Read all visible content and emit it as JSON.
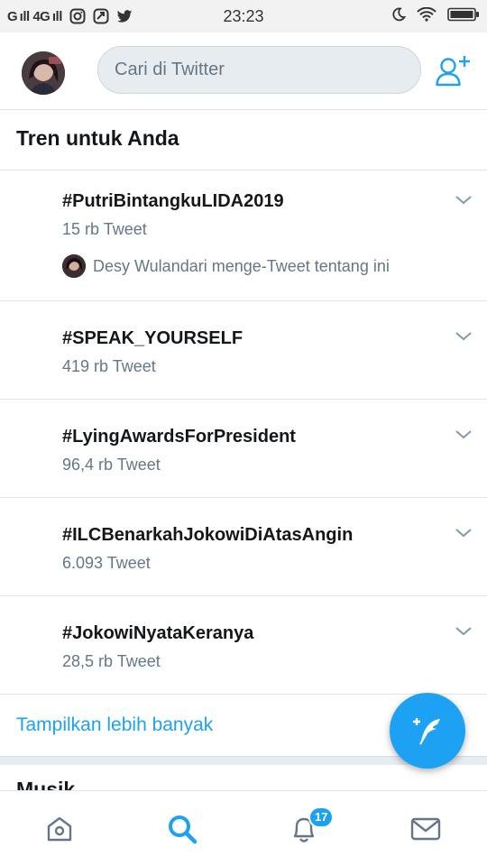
{
  "status_bar": {
    "signal": "G ıll 4G ıll",
    "time": "23:23",
    "icons": [
      "instagram-icon",
      "app-icon",
      "twitter-icon",
      "moon-icon",
      "wifi-icon",
      "battery-icon"
    ]
  },
  "header": {
    "search_placeholder": "Cari di Twitter",
    "avatar": "profile-avatar",
    "add_user_icon": "add-user-icon"
  },
  "trends": {
    "title": "Tren untuk Anda",
    "items": [
      {
        "name": "#PutriBintangkuLIDA2019",
        "count": "15 rb Tweet",
        "context": "Desy Wulandari menge-Tweet tentang ini"
      },
      {
        "name": "#SPEAK_YOURSELF",
        "count": "419 rb Tweet"
      },
      {
        "name": "#LyingAwardsForPresident",
        "count": "96,4 rb Tweet"
      },
      {
        "name": "#ILCBenarkahJokowiDiAtasAngin",
        "count": "6.093 Tweet"
      },
      {
        "name": "#JokowiNyataKeranya",
        "count": "28,5 rb Tweet"
      }
    ],
    "show_more": "Tampilkan lebih banyak"
  },
  "next_section_title": "Musik",
  "bottom_nav": {
    "items": [
      "home-icon",
      "search-icon",
      "notifications-icon",
      "messages-icon"
    ],
    "active": "search-icon",
    "notification_badge": "17"
  },
  "colors": {
    "accent": "#1da1f2",
    "text_primary": "#14171a",
    "text_secondary": "#657786",
    "divider": "#e1e8ed"
  }
}
